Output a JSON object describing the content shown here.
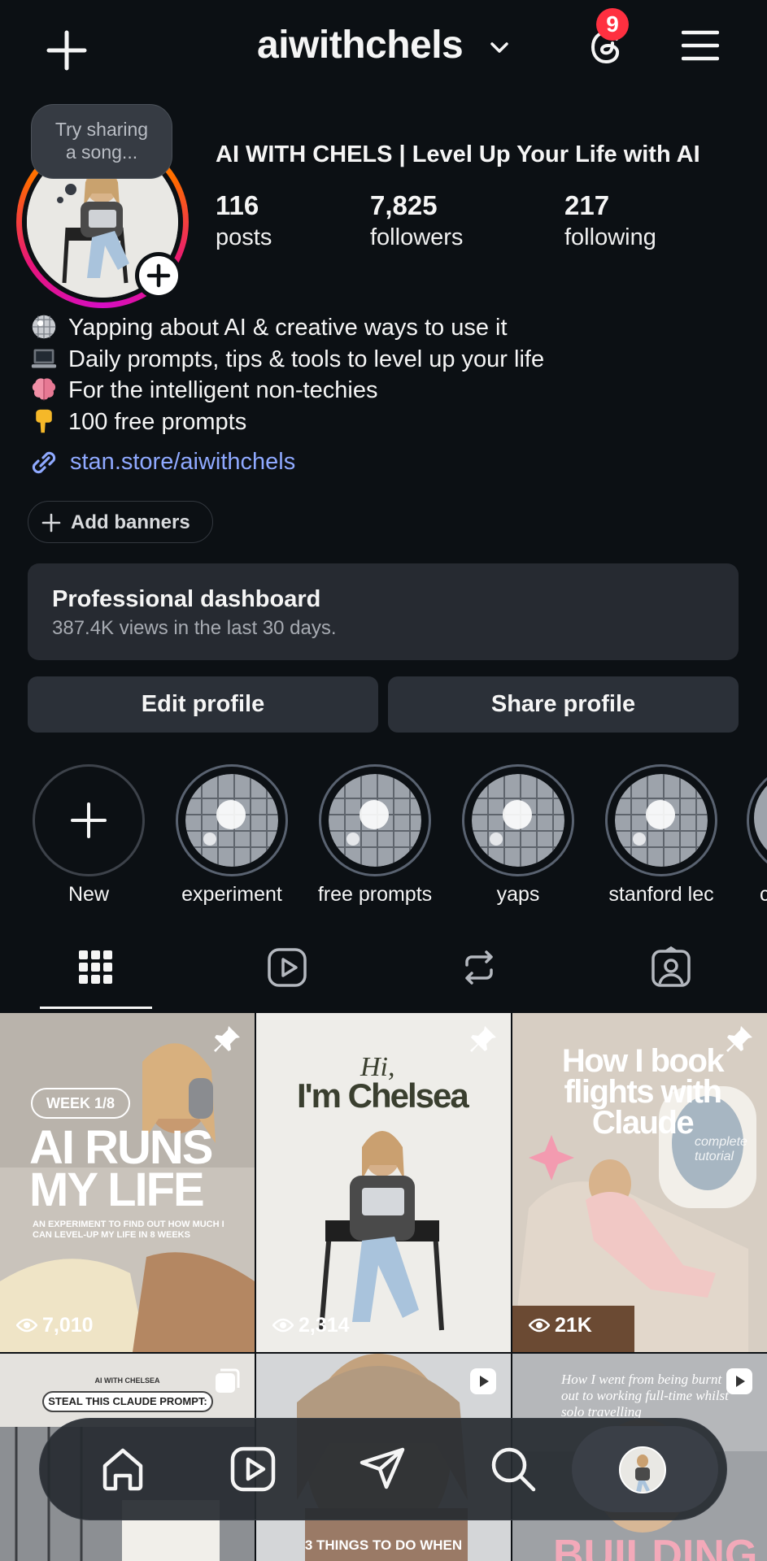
{
  "header": {
    "username": "aiwithchels",
    "notification_count": "9",
    "icons": [
      "plus-icon",
      "chevron-down-icon",
      "threads-icon",
      "menu-icon"
    ]
  },
  "profile": {
    "note_bubble": "Try sharing\na song...",
    "full_name": "AI WITH CHELS | Level Up Your Life with AI",
    "stats": [
      {
        "value": "116",
        "label": "posts"
      },
      {
        "value": "7,825",
        "label": "followers"
      },
      {
        "value": "217",
        "label": "following"
      }
    ],
    "bio": [
      {
        "icon": "disco-ball-icon",
        "text": "Yapping about AI & creative ways to use it"
      },
      {
        "icon": "laptop-icon",
        "text": "Daily prompts, tips & tools to level up your life"
      },
      {
        "icon": "brain-icon",
        "text": "For the intelligent non-techies"
      },
      {
        "icon": "pointing-down-icon",
        "text": "100 free prompts"
      }
    ],
    "link": "stan.store/aiwithchels",
    "add_banners": "Add banners"
  },
  "dashboard": {
    "title": "Professional dashboard",
    "subtitle": "387.4K views in the last 30 days."
  },
  "actions": {
    "edit": "Edit profile",
    "share": "Share profile"
  },
  "highlights": [
    {
      "label": "New"
    },
    {
      "label": "experiment"
    },
    {
      "label": "free prompts"
    },
    {
      "label": "yaps"
    },
    {
      "label": "stanford lec"
    },
    {
      "label": "c"
    }
  ],
  "posts": [
    {
      "badge": "WEEK 1/8",
      "headline": "AI RUNS MY LIFE",
      "caption": "AN EXPERIMENT TO FIND OUT HOW MUCH I CAN LEVEL-UP MY LIFE IN 8 WEEKS",
      "views": "7,010"
    },
    {
      "headline_small": "Hi,",
      "headline": "I'm Chelsea",
      "views": "2,314"
    },
    {
      "headline": "How I book flights with Claude",
      "script": "complete tutorial",
      "views": "21K"
    },
    {
      "small_top": "AI WITH CHELSEA",
      "badge": "STEAL THIS CLAUDE PROMPT:"
    },
    {
      "caption": "3 THINGS TO DO WHEN"
    },
    {
      "script": "How I went from being burnt out to working full-time whilst solo travelling",
      "headline": "BUILDING"
    }
  ],
  "colors": {
    "background": "#0c1014",
    "card": "#262a31",
    "button": "#2b3038",
    "link": "#8fa9ff",
    "badge": "#ff3040"
  }
}
